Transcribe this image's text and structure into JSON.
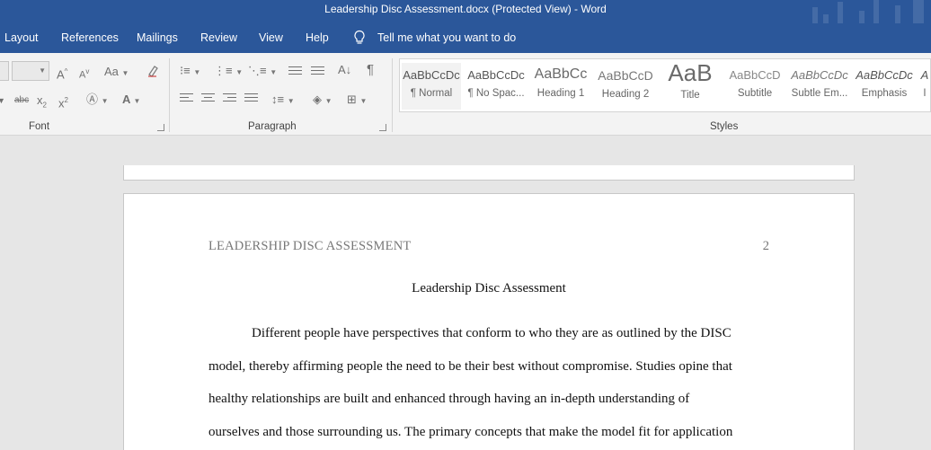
{
  "window": {
    "title": "Leadership Disc Assessment.docx (Protected View)  -  Word"
  },
  "menu": {
    "items": [
      "Layout",
      "References",
      "Mailings",
      "Review",
      "View",
      "Help"
    ],
    "tell_me": "Tell me what you want to do"
  },
  "ribbon": {
    "groups": {
      "font": "Font",
      "paragraph": "Paragraph",
      "styles": "Styles"
    },
    "font_buttons": {
      "change_case": "Aa",
      "grow": "A",
      "shrink": "A",
      "strike": "abc",
      "subscript": "x",
      "subscript_mark": "2",
      "superscript": "x",
      "superscript_mark": "2",
      "font_color": "A"
    },
    "styles": [
      {
        "sample": "AaBbCcDc",
        "name": "¶ Normal"
      },
      {
        "sample": "AaBbCcDc",
        "name": "¶ No Spac..."
      },
      {
        "sample": "AaBbCc",
        "name": "Heading 1"
      },
      {
        "sample": "AaBbCcD",
        "name": "Heading 2"
      },
      {
        "sample": "AaB",
        "name": "Title"
      },
      {
        "sample": "AaBbCcD",
        "name": "Subtitle"
      },
      {
        "sample": "AaBbCcDc",
        "name": "Subtle Em..."
      },
      {
        "sample": "AaBbCcDc",
        "name": "Emphasis"
      },
      {
        "sample": "A",
        "name": "I"
      }
    ]
  },
  "document": {
    "running_head": "LEADERSHIP DISC ASSESSMENT",
    "page_number": "2",
    "title": "Leadership Disc Assessment",
    "lines": [
      "Different people have perspectives that conform to who they are as outlined by the DISC",
      "model, thereby affirming people the need to be their best without compromise. Studies opine that",
      "healthy relationships are built and enhanced through having an in-depth understanding of",
      "ourselves and those surrounding us. The primary concepts that make the model fit for application"
    ]
  }
}
